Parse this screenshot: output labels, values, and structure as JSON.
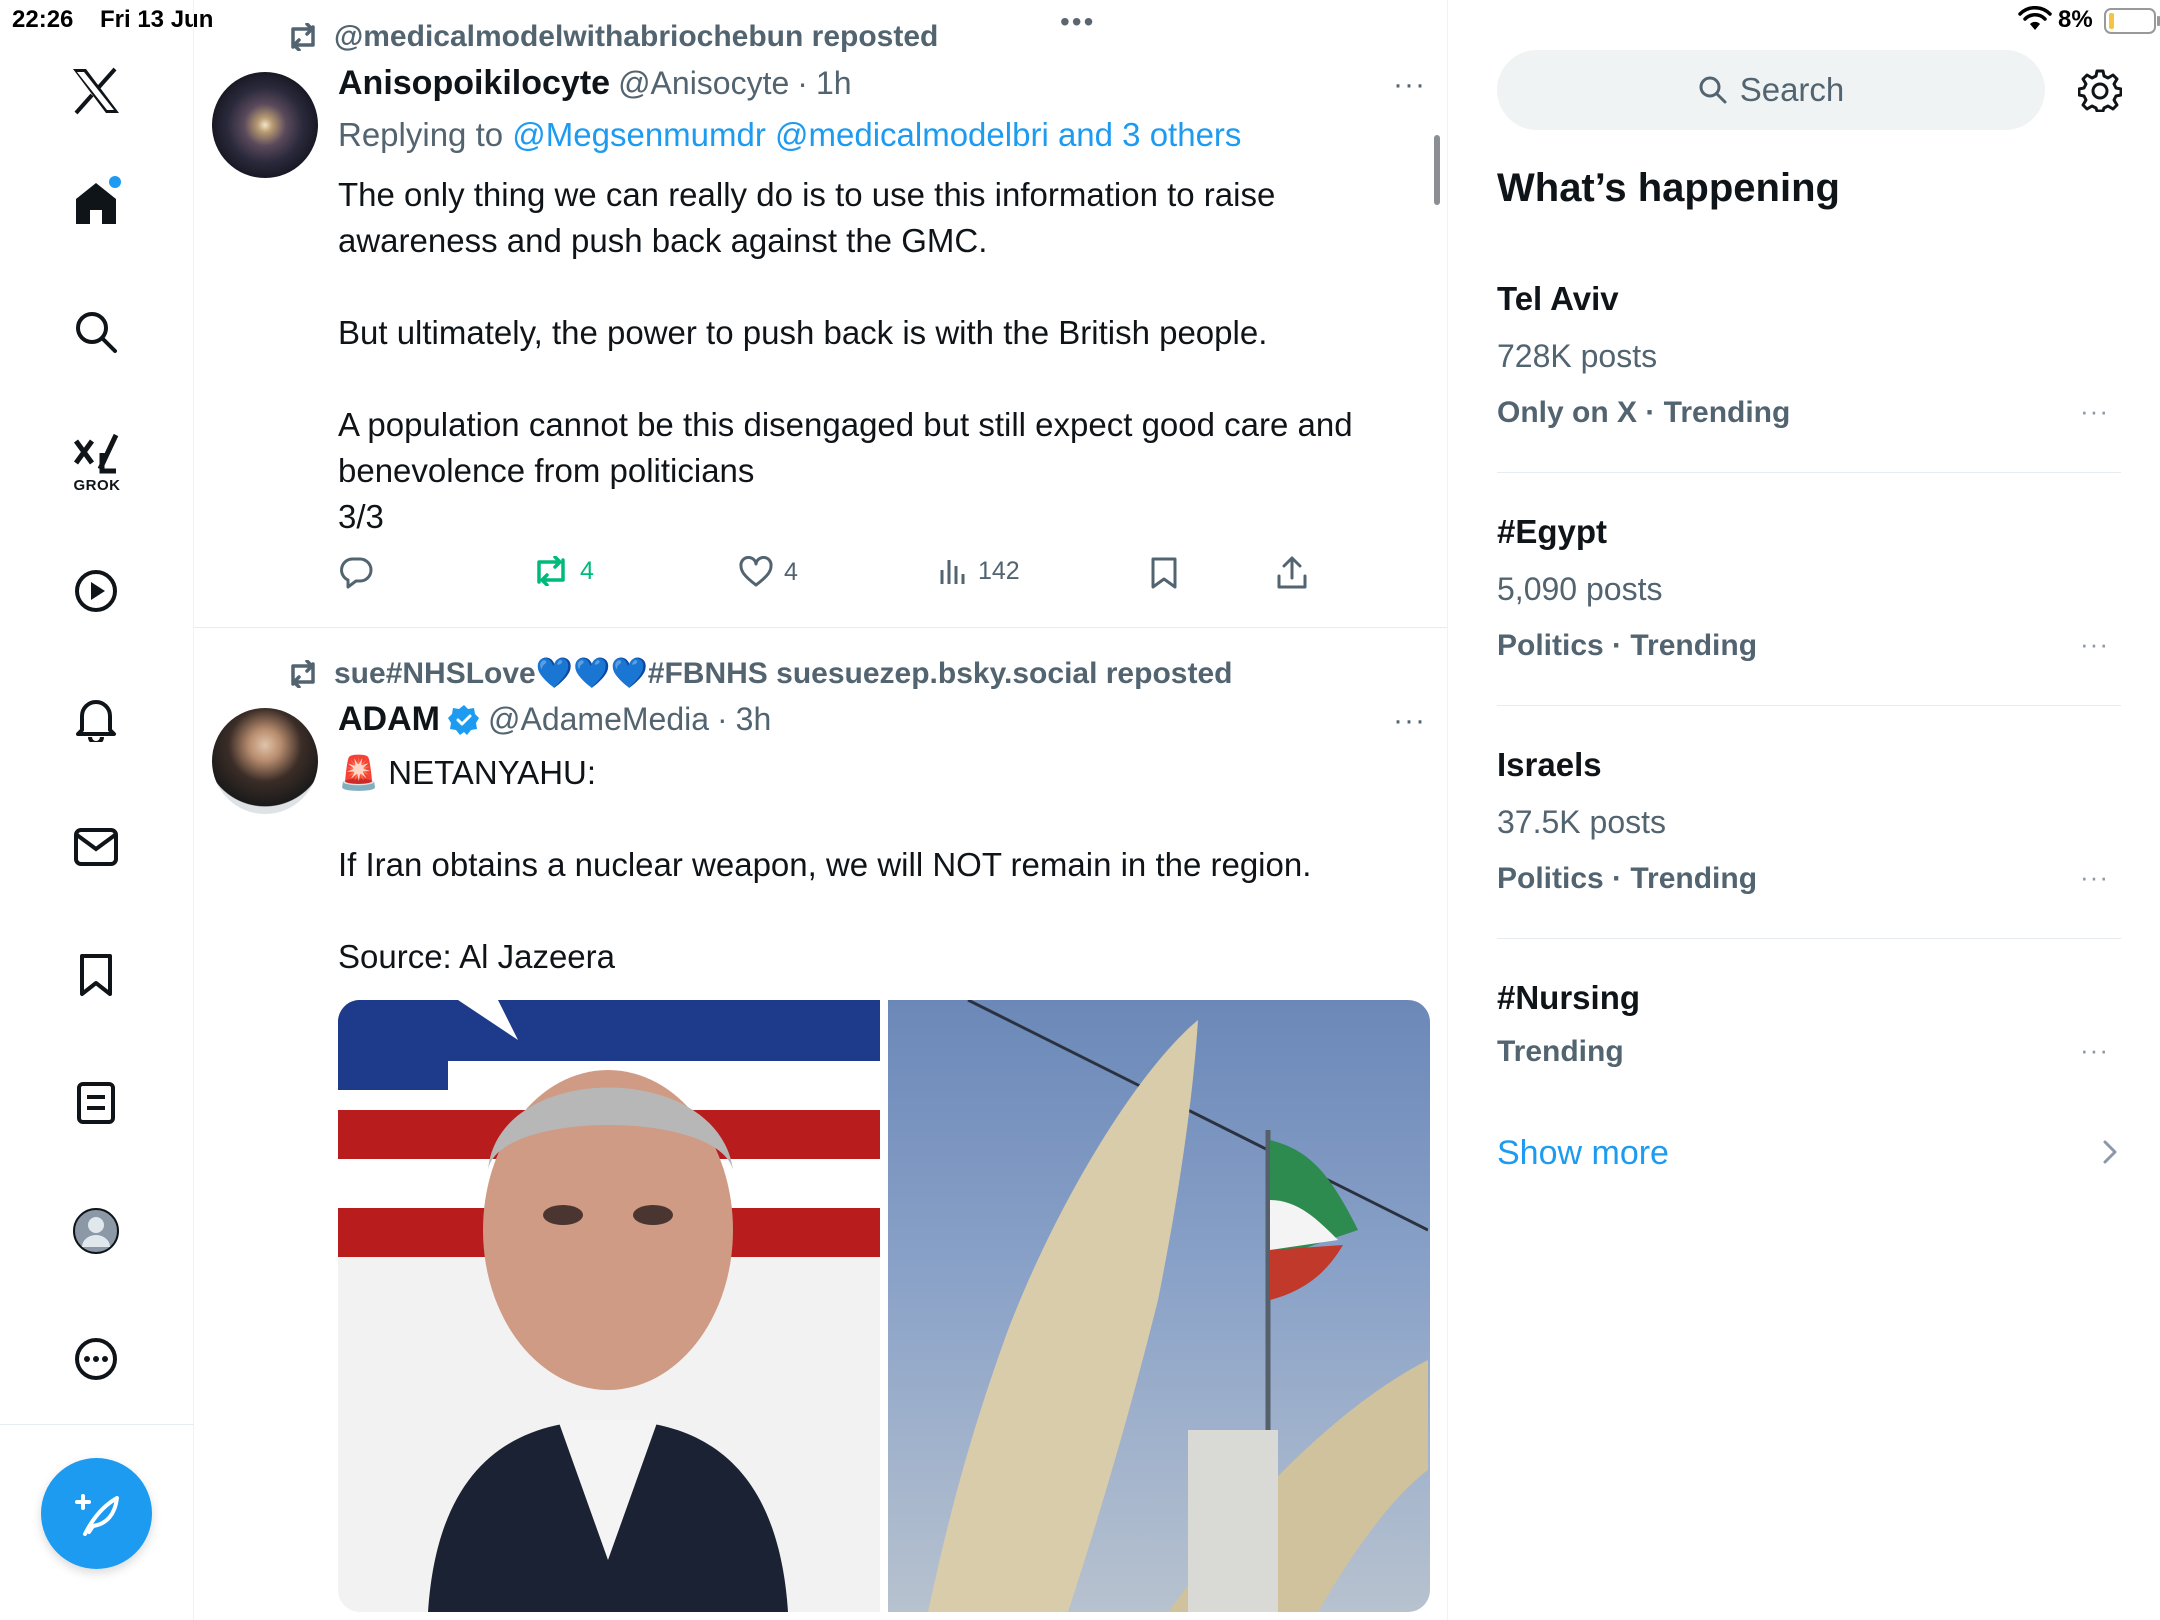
{
  "status_bar": {
    "time": "22:26",
    "date": "Fri 13 Jun",
    "battery": "8%",
    "multitask_dots": "•••"
  },
  "nav": {
    "grok_label": "GROK",
    "items": [
      "x-logo",
      "home",
      "explore",
      "grok",
      "video",
      "notifications",
      "messages",
      "bookmarks",
      "lists",
      "profile",
      "more"
    ]
  },
  "feed": {
    "post1": {
      "repost_by": "@medicalmodelwithabriochebun reposted",
      "display_name": "Anisopoikilocyte",
      "handle": "@Anisocyte",
      "sep": "·",
      "time": "1h",
      "more": "···",
      "replying_prefix": "Replying to ",
      "replying_to": "@Megsenmumdr @medicalmodelbri and 3 others",
      "text": "The only thing we can really do is to use this information to raise awareness and push back against the GMC.\n\nBut ultimately, the power to push back is with the British people.\n\nA population cannot be this disengaged but still expect good care and benevolence from politicians\n3/3",
      "reposts": "4",
      "likes": "4",
      "views": "142"
    },
    "post2": {
      "repost_by": "sue#NHSLove💙💙💙#FBNHS suesuezep.bsky.social reposted",
      "display_name": "ADAM",
      "handle": "@AdameMedia",
      "sep": "·",
      "time": "3h",
      "more": "···",
      "text": "🚨 NETANYAHU:\n\nIf Iran obtains a nuclear weapon, we will NOT remain in the region.\n\nSource: Al Jazeera"
    }
  },
  "sidebar": {
    "search_placeholder": "Search",
    "title": "What’s happening",
    "trends": [
      {
        "name": "Tel Aviv",
        "count": "728K posts",
        "meta": "Only on X · Trending"
      },
      {
        "name": "#Egypt",
        "count": "5,090 posts",
        "meta": "Politics · Trending"
      },
      {
        "name": "Israels",
        "count": "37.5K posts",
        "meta": "Politics · Trending"
      },
      {
        "name": "#Nursing",
        "count": "",
        "meta": "Trending"
      }
    ],
    "trend_more": "···",
    "show_more": "Show more"
  },
  "colors": {
    "accent": "#1d9bf0",
    "repost_green": "#00ba7c",
    "secondary_text": "#536471"
  }
}
